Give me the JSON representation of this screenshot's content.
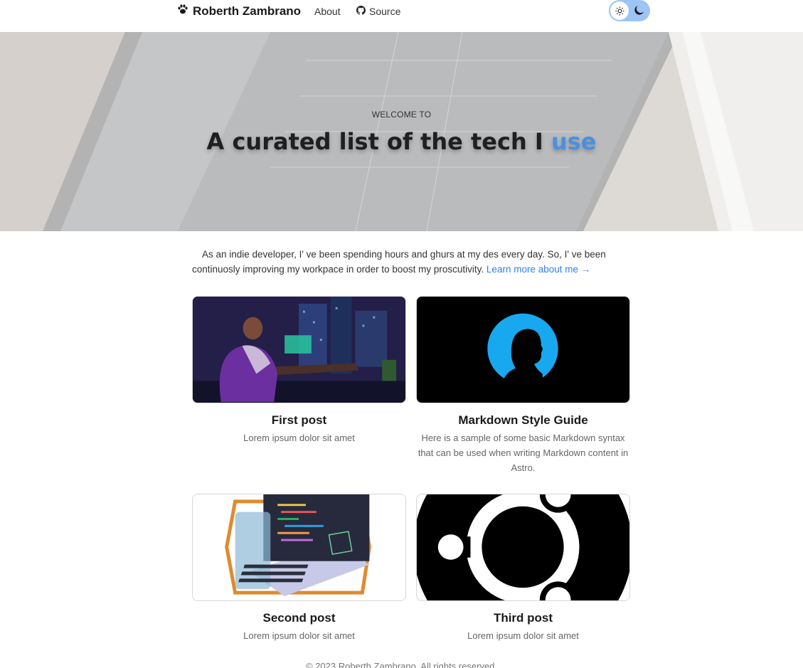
{
  "header": {
    "brand": "Roberth Zambrano",
    "nav": {
      "about": "About",
      "source": "Source"
    }
  },
  "hero": {
    "subtitle": "WELCOME TO",
    "title_main": "A curated list of the tech I ",
    "title_accent": "use"
  },
  "intro": {
    "text": "As an indie developer, I' ve been spending hours and ghurs at my des every day. So, I' ve been continuosly improving my workpace in order to boost my proscutivity. ",
    "link": "Learn more about me →"
  },
  "posts": [
    {
      "title": "First post",
      "description": "Lorem ipsum dolor sit amet"
    },
    {
      "title": "Markdown Style Guide",
      "description": "Here is a sample of some basic Markdown syntax that can be used when writing Markdown content in Astro."
    },
    {
      "title": "Second post",
      "description": "Lorem ipsum dolor sit amet"
    },
    {
      "title": "Third post",
      "description": "Lorem ipsum dolor sit amet"
    }
  ],
  "footer": {
    "text": "© 2023 Roberth Zambrano. All rights reserved."
  },
  "colors": {
    "accent": "#4a90e2",
    "link": "#2f80ed",
    "toggle": "#9cc4f5"
  }
}
